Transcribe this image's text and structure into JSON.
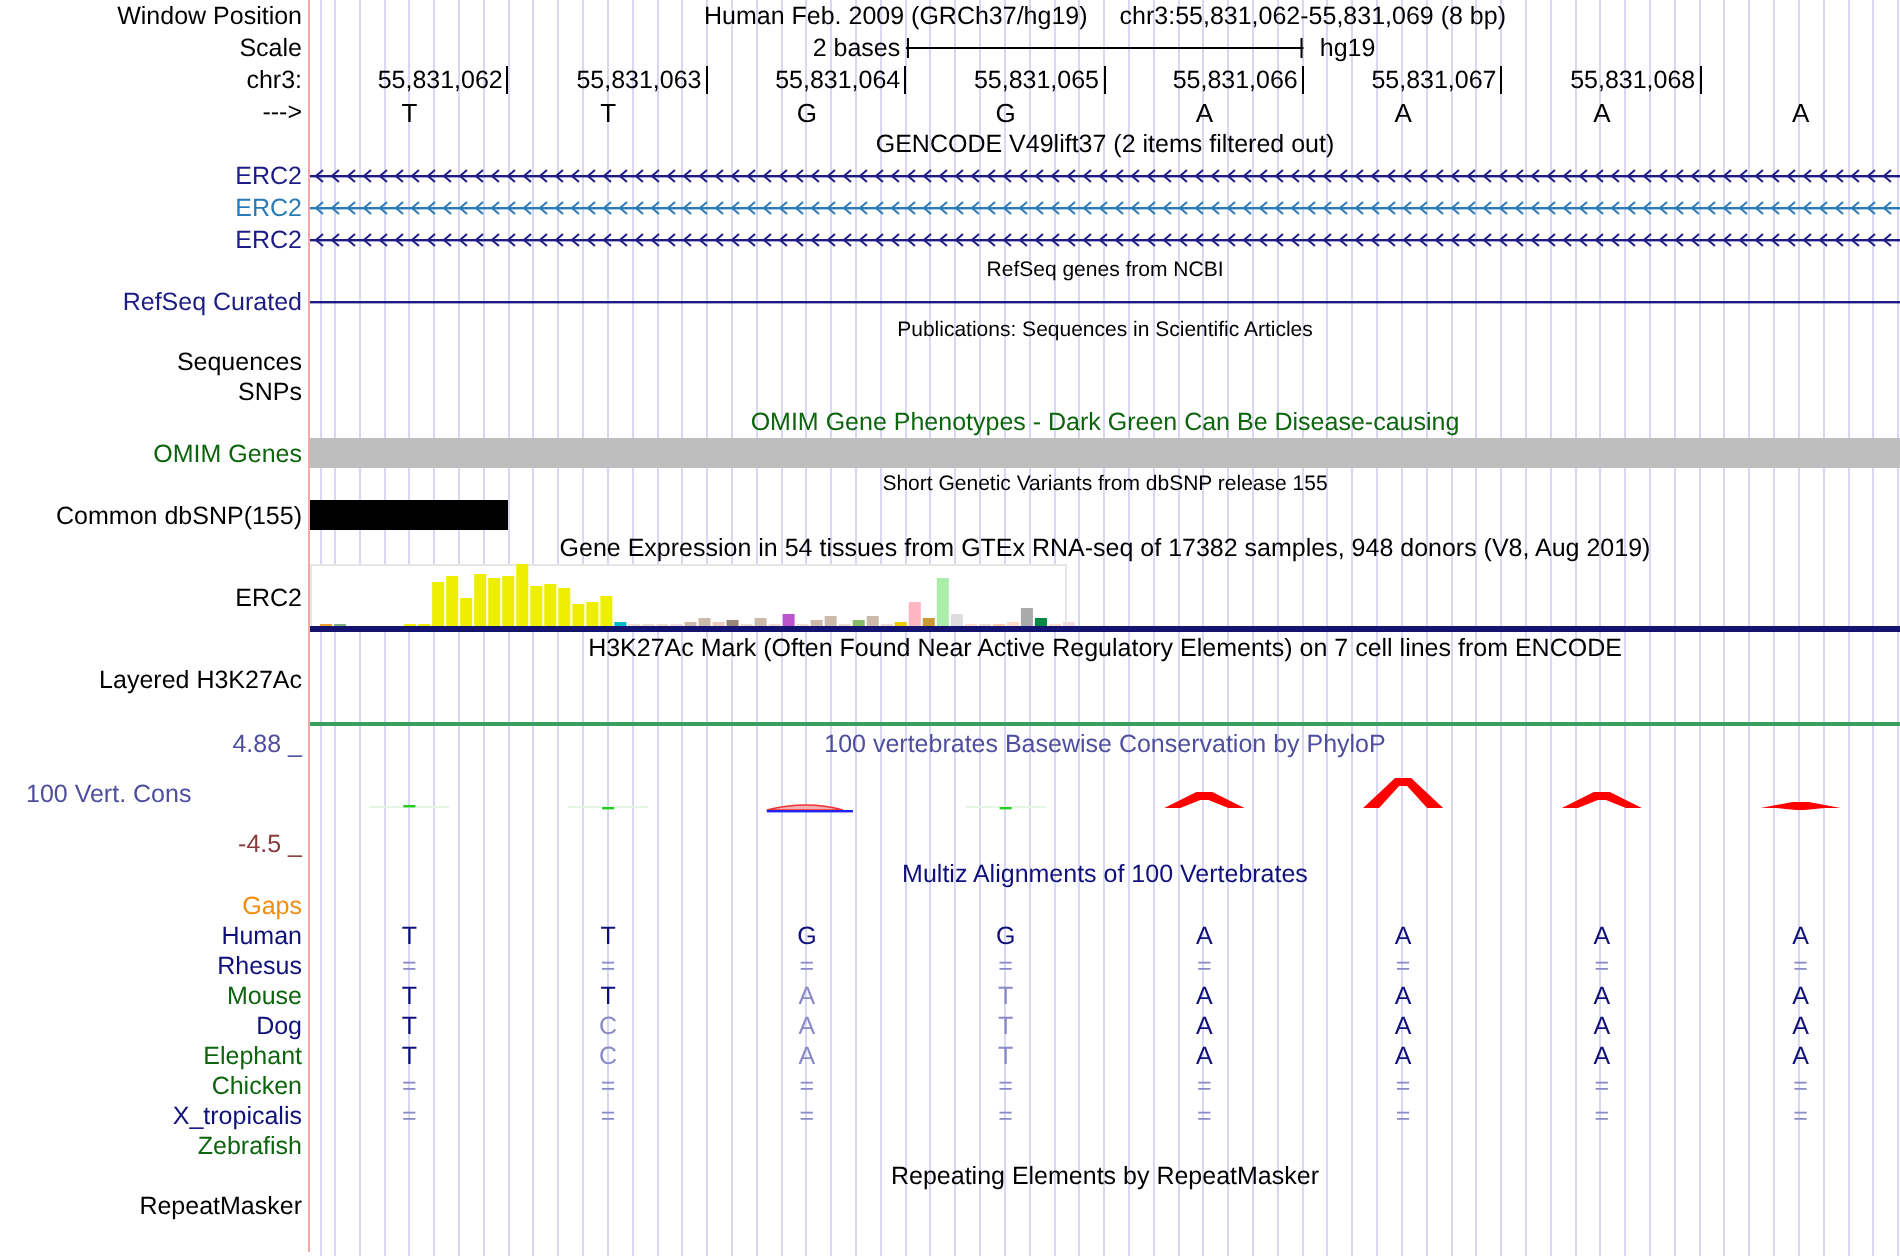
{
  "header": {
    "position_label": "Window Position",
    "assembly": "Human Feb. 2009 (GRCh37/hg19)",
    "position": "chr3:55,831,062-55,831,069 (8 bp)",
    "scale_label": "Scale",
    "scale_length": "2 bases",
    "scale_db": "hg19",
    "chrom_label": "chr3:",
    "ruler_ticks": [
      "55,831,062",
      "55,831,063",
      "55,831,064",
      "55,831,065",
      "55,831,066",
      "55,831,067",
      "55,831,068"
    ],
    "strand_label": "--->",
    "bases": [
      "T",
      "T",
      "G",
      "G",
      "A",
      "A",
      "A",
      "A"
    ]
  },
  "tracks": [
    {
      "kind": "title",
      "text": "GENCODE V49lift37 (2 items filtered out)",
      "color": "#000000"
    },
    {
      "kind": "gene",
      "label": "ERC2",
      "color": "#1c1c84"
    },
    {
      "kind": "gene",
      "label": "ERC2",
      "color": "#2a7bb5"
    },
    {
      "kind": "gene",
      "label": "ERC2",
      "color": "#1c1c84"
    },
    {
      "kind": "subtitle",
      "text": "RefSeq genes from NCBI",
      "color": "#000000"
    },
    {
      "kind": "line",
      "label": "RefSeq Curated",
      "color": "#1c1c84"
    },
    {
      "kind": "subtitle",
      "text": "Publications: Sequences in Scientific Articles",
      "color": "#000000"
    },
    {
      "kind": "label",
      "label": "Sequences",
      "color": "#000000"
    },
    {
      "kind": "label",
      "label": "SNPs",
      "color": "#000000"
    },
    {
      "kind": "title",
      "text": "OMIM Gene Phenotypes - Dark Green Can Be Disease-causing",
      "color": "#0c640c"
    },
    {
      "kind": "omim_bar",
      "label": "OMIM Genes",
      "color": "#0c640c"
    },
    {
      "kind": "subtitle",
      "text": "Short Genetic Variants from dbSNP release 155",
      "color": "#000000"
    },
    {
      "kind": "snp_bar",
      "label": "Common dbSNP(155)",
      "color": "#000000"
    },
    {
      "kind": "title",
      "text": "Gene Expression in 54 tissues from GTEx RNA-seq of 17382 samples, 948 donors (V8, Aug 2019)",
      "color": "#000000"
    },
    {
      "kind": "expression",
      "label": "ERC2",
      "color": "#000000"
    },
    {
      "kind": "title",
      "text": "H3K27Ac Mark (Often Found Near Active Regulatory Elements) on 7 cell lines from ENCODE",
      "color": "#000000"
    },
    {
      "kind": "layered",
      "label": "Layered H3K27Ac",
      "color": "#000000"
    },
    {
      "kind": "conservation",
      "max_label": "4.88 _",
      "title": "100 vertebrates Basewise Conservation by PhyloP",
      "label": "100 Vert. Cons",
      "min_label": "-4.5 _",
      "color": "#4e4e9c"
    },
    {
      "kind": "title",
      "text": "Multiz Alignments of 100 Vertebrates",
      "color": "#10107a"
    },
    {
      "kind": "label",
      "label": "Gaps",
      "color": "#f08c10"
    },
    {
      "kind": "species",
      "label": "Human",
      "color": "#10107a",
      "bases": [
        "T",
        "T",
        "G",
        "G",
        "A",
        "A",
        "A",
        "A"
      ],
      "dim": [
        false,
        false,
        false,
        false,
        false,
        false,
        false,
        false
      ]
    },
    {
      "kind": "species",
      "label": "Rhesus",
      "color": "#10107a",
      "bases": [
        "=",
        "=",
        "=",
        "=",
        "=",
        "=",
        "=",
        "="
      ],
      "dim": [
        true,
        true,
        true,
        true,
        true,
        true,
        true,
        true
      ]
    },
    {
      "kind": "species",
      "label": "Mouse",
      "color": "#0c640c",
      "bases": [
        "T",
        "T",
        "A",
        "T",
        "A",
        "A",
        "A",
        "A"
      ],
      "dim": [
        false,
        false,
        true,
        true,
        false,
        false,
        false,
        false
      ]
    },
    {
      "kind": "species",
      "label": "Dog",
      "color": "#10107a",
      "bases": [
        "T",
        "C",
        "A",
        "T",
        "A",
        "A",
        "A",
        "A"
      ],
      "dim": [
        false,
        true,
        true,
        true,
        false,
        false,
        false,
        false
      ]
    },
    {
      "kind": "species",
      "label": "Elephant",
      "color": "#0c640c",
      "bases": [
        "T",
        "C",
        "A",
        "T",
        "A",
        "A",
        "A",
        "A"
      ],
      "dim": [
        false,
        true,
        true,
        true,
        false,
        false,
        false,
        false
      ]
    },
    {
      "kind": "species",
      "label": "Chicken",
      "color": "#0c640c",
      "bases": [
        "=",
        "=",
        "=",
        "=",
        "=",
        "=",
        "=",
        "="
      ],
      "dim": [
        true,
        true,
        true,
        true,
        true,
        true,
        true,
        true
      ]
    },
    {
      "kind": "species",
      "label": "X_tropicalis",
      "color": "#10107a",
      "bases": [
        "=",
        "=",
        "=",
        "=",
        "=",
        "=",
        "=",
        "="
      ],
      "dim": [
        true,
        true,
        true,
        true,
        true,
        true,
        true,
        true
      ]
    },
    {
      "kind": "label",
      "label": "Zebrafish",
      "color": "#0c640c"
    },
    {
      "kind": "title",
      "text": "Repeating Elements by RepeatMasker",
      "color": "#000000"
    },
    {
      "kind": "tall_label",
      "label": "RepeatMasker",
      "color": "#000000"
    }
  ]
}
